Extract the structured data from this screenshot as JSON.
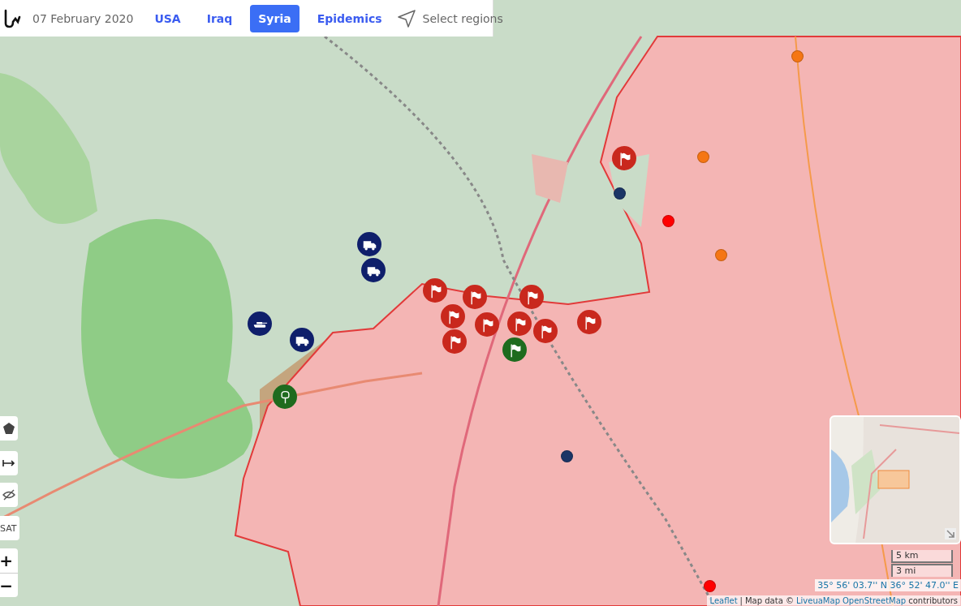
{
  "top_bar": {
    "date": "07 February 2020",
    "tabs": [
      {
        "label": "USA",
        "selected": false
      },
      {
        "label": "Iraq",
        "selected": false
      },
      {
        "label": "Syria",
        "selected": true
      },
      {
        "label": "Epidemics",
        "selected": false
      }
    ],
    "select_regions": "Select regions"
  },
  "map": {
    "kind": "picture",
    "markers": [
      {
        "kind": "truck",
        "color": "#0f1f6b"
      },
      {
        "kind": "truck",
        "color": "#0f1f6b"
      },
      {
        "kind": "tank",
        "color": "#0f1f6b"
      },
      {
        "kind": "truck",
        "color": "#0f1f6b"
      },
      {
        "kind": "tree",
        "color": "#1e6b1e"
      },
      {
        "kind": "flag",
        "color": "#c9281d"
      },
      {
        "kind": "flag",
        "color": "#c9281d"
      },
      {
        "kind": "flag",
        "color": "#c9281d"
      },
      {
        "kind": "flag",
        "color": "#c9281d"
      },
      {
        "kind": "flag",
        "color": "#c9281d"
      },
      {
        "kind": "flag",
        "color": "#c9281d"
      },
      {
        "kind": "flag",
        "color": "#c9281d"
      },
      {
        "kind": "flag",
        "color": "#c9281d"
      },
      {
        "kind": "flag",
        "color": "#c9281d"
      },
      {
        "kind": "flag",
        "color": "#c9281d"
      },
      {
        "kind": "flag",
        "color": "#1e6b1e"
      },
      {
        "kind": "dot",
        "color": "#1b3566"
      },
      {
        "kind": "dot",
        "color": "#1b3566"
      },
      {
        "kind": "dot",
        "color": "#ff0000"
      },
      {
        "kind": "dot",
        "color": "#ff0000"
      },
      {
        "kind": "dot",
        "color": "#f57614"
      },
      {
        "kind": "dot",
        "color": "#f57614"
      },
      {
        "kind": "dot",
        "color": "#f57614"
      }
    ]
  },
  "controls": [
    {
      "kind": "polygon"
    },
    {
      "kind": "measure"
    },
    {
      "kind": "hide"
    },
    {
      "kind": "text",
      "label": "SAT"
    }
  ],
  "zoom": {
    "in": "+",
    "out": "−"
  },
  "scale": {
    "metric": "5 km",
    "imperial": "3 mi"
  },
  "coordinates": "35° 56' 03.7'' N 36° 52' 47.0'' E",
  "attribution": {
    "leaflet": "Leaflet",
    "separator": "|",
    "text": "Map data ©",
    "links": [
      "LiveuaMap",
      "OpenStreetMap"
    ],
    "suffix": "contributors"
  }
}
